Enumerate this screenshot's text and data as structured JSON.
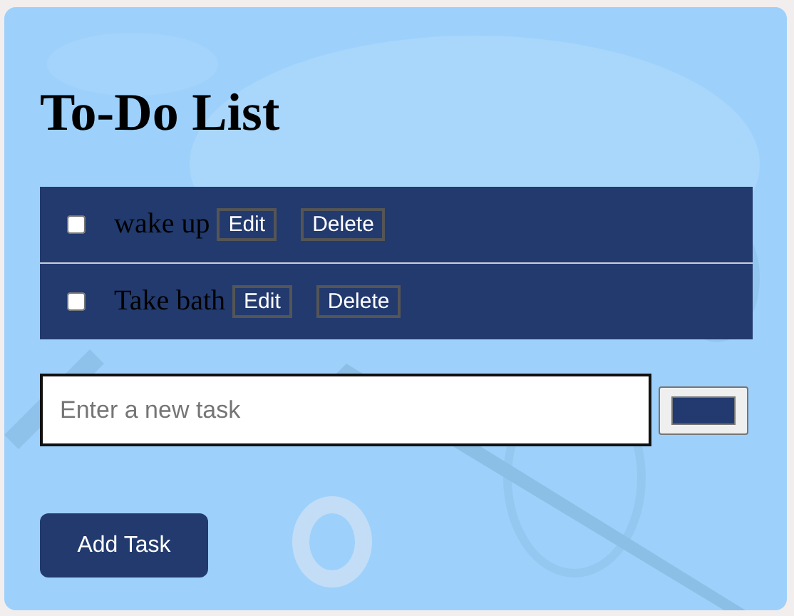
{
  "title": "To-Do List",
  "tasks": [
    {
      "text": "wake up",
      "checked": false,
      "edit": "Edit",
      "delete": "Delete"
    },
    {
      "text": "Take bath",
      "checked": false,
      "edit": "Edit",
      "delete": "Delete"
    }
  ],
  "new_task": {
    "placeholder": "Enter a new task"
  },
  "color_picker": {
    "color": "#223a70"
  },
  "add_button": "Add Task"
}
